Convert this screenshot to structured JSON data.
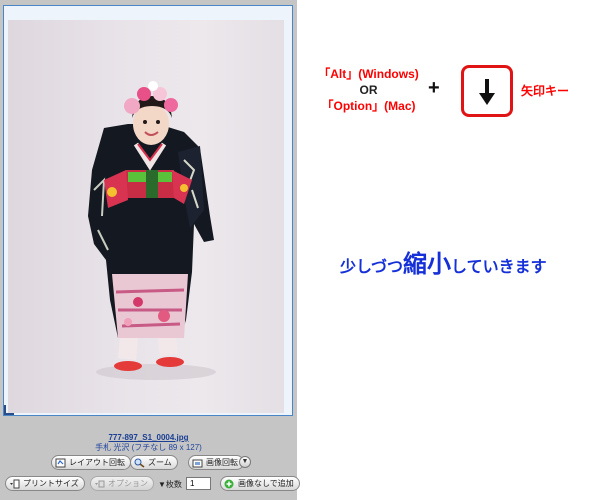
{
  "viewer": {
    "filename": "777-897_S1_0004.jpg",
    "subtitle": "手札 光沢 (フチなし 89 x 127)"
  },
  "toolbar": {
    "layout_rotate_label": "レイアウト回転",
    "zoom_label": "ズーム",
    "image_rotate_label": "画像回転",
    "print_size_label": "プリントサイズ",
    "option_label": "オプション",
    "count_label": "▼枚数",
    "count_value": "1",
    "add_without_image_label": "画像なしで追加"
  },
  "instructions": {
    "key_alt": "「Alt」(Windows)",
    "or": "OR",
    "key_option": "「Option」(Mac)",
    "plus": "+",
    "arrow_key_label": "矢印キー",
    "message_1": "少しづつ",
    "message_2": "縮小",
    "message_3": "していきます"
  },
  "colors": {
    "instruction_red": "#ff0000",
    "message_blue": "#1530d8",
    "filename_blue": "#1a3f94"
  },
  "icons": [
    "down-arrow-icon",
    "layout-rotate-icon",
    "zoom-icon",
    "image-rotate-icon",
    "print-size-icon",
    "option-icon",
    "add-icon",
    "chevron-down-icon"
  ]
}
